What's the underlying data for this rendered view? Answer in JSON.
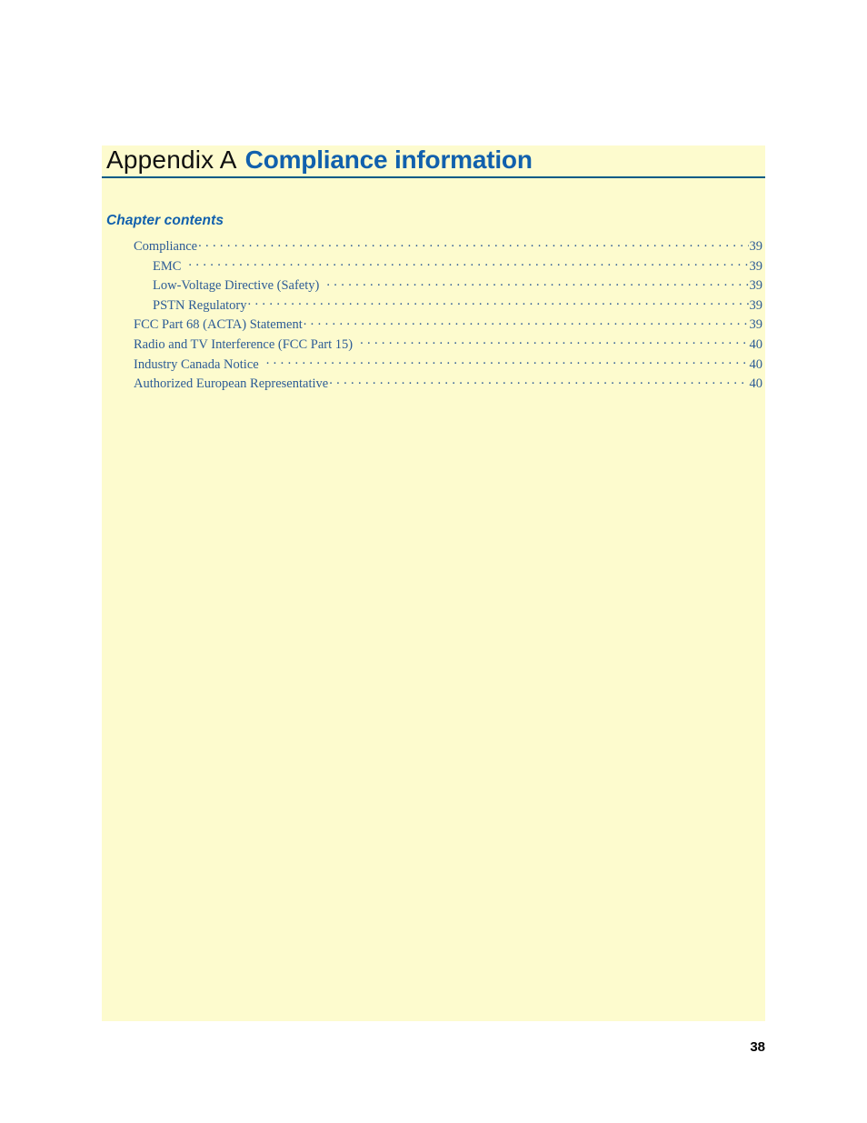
{
  "document": {
    "appendix_label": "Appendix A",
    "appendix_title": "Compliance information",
    "chapter_contents_heading": "Chapter contents",
    "footer_page_number": "38"
  },
  "colors": {
    "content_background": "#fdfbce",
    "rule": "#005b86",
    "title_accent": "#1160ad",
    "title_label": "#101010",
    "toc_text": "#2c5b96",
    "page_background": "#ffffff",
    "footer_text": "#000000"
  },
  "toc": {
    "entries": [
      {
        "label": "Compliance",
        "page": "39",
        "level": 1,
        "trailing_space": false
      },
      {
        "label": "EMC",
        "page": "39",
        "level": 2,
        "trailing_space": true
      },
      {
        "label": "Low-Voltage Directive (Safety)",
        "page": "39",
        "level": 2,
        "trailing_space": true
      },
      {
        "label": "PSTN Regulatory",
        "page": "39",
        "level": 2,
        "trailing_space": false
      },
      {
        "label": "FCC Part 68 (ACTA) Statement",
        "page": "39",
        "level": 1,
        "trailing_space": false
      },
      {
        "label": "Radio and TV Interference (FCC Part 15)",
        "page": "40",
        "level": 1,
        "trailing_space": true
      },
      {
        "label": "Industry Canada Notice",
        "page": "40",
        "level": 1,
        "trailing_space": true
      },
      {
        "label": "Authorized European Representative",
        "page": "40",
        "level": 1,
        "trailing_space": false
      }
    ]
  }
}
